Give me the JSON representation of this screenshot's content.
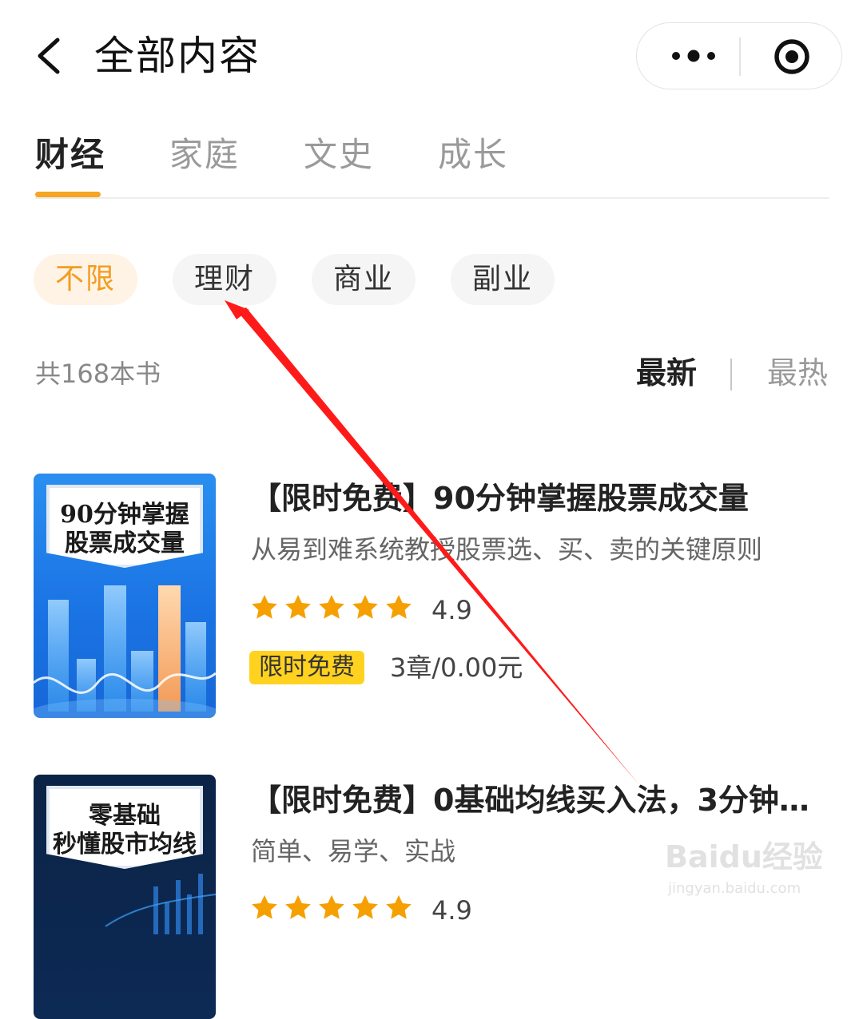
{
  "header": {
    "title": "全部内容",
    "icons": {
      "back": "chevron-left-icon",
      "more": "more-dots-icon",
      "target": "record-target-icon"
    }
  },
  "tabs": [
    {
      "label": "财经",
      "active": true
    },
    {
      "label": "家庭",
      "active": false
    },
    {
      "label": "文史",
      "active": false
    },
    {
      "label": "成长",
      "active": false
    }
  ],
  "chips": [
    {
      "label": "不限",
      "active": true
    },
    {
      "label": "理财",
      "active": false
    },
    {
      "label": "商业",
      "active": false
    },
    {
      "label": "副业",
      "active": false
    }
  ],
  "list_header": {
    "count": "共168本书",
    "sort_newest": "最新",
    "sort_hot": "最热",
    "selected_sort": "最新"
  },
  "books": [
    {
      "cover_line1": "90分钟掌握",
      "cover_line2": "股票成交量",
      "title": "【限时免费】90分钟掌握股票成交量",
      "subtitle": "从易到难系统教授股票选、买、卖的关键原则",
      "stars": 5,
      "rating": "4.9",
      "badge": "限时免费",
      "chapters": "3章/0.00元"
    },
    {
      "cover_line1": "零基础",
      "cover_line2": "秒懂股市均线",
      "title": "【限时免费】0基础均线买入法，3分钟…",
      "subtitle": "简单、易学、实战",
      "stars": 5,
      "rating": "4.9"
    }
  ],
  "colors": {
    "accent": "#f5a623",
    "chip_active_bg": "#fff3e6",
    "chip_active_text": "#f39c1f",
    "star": "#f5a000",
    "badge_bg": "#ffd21f",
    "annotation_arrow": "#ff1a1a"
  },
  "watermark": {
    "brand": "Baidu经验",
    "url": "jingyan.baidu.com"
  }
}
